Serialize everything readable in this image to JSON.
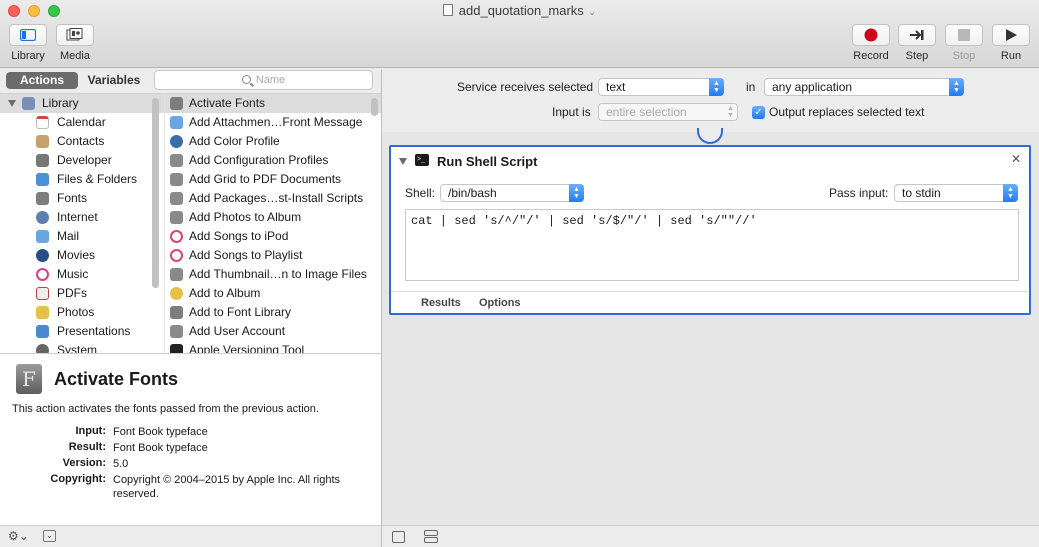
{
  "window": {
    "title": "add_quotation_marks"
  },
  "toolbar": {
    "library_label": "Library",
    "media_label": "Media",
    "record_label": "Record",
    "step_label": "Step",
    "stop_label": "Stop",
    "run_label": "Run"
  },
  "library": {
    "tab_actions": "Actions",
    "tab_variables": "Variables",
    "search_placeholder": "Name",
    "categories": [
      {
        "label": "Library",
        "icon": "library-icon",
        "color": "#7a8fb5"
      },
      {
        "label": "Calendar",
        "icon": "calendar-icon",
        "color": "#e8e8e8"
      },
      {
        "label": "Contacts",
        "icon": "contacts-icon",
        "color": "#c8a070"
      },
      {
        "label": "Developer",
        "icon": "developer-icon",
        "color": "#777777"
      },
      {
        "label": "Files & Folders",
        "icon": "finder-icon",
        "color": "#4a90d9"
      },
      {
        "label": "Fonts",
        "icon": "fonts-icon",
        "color": "#7d7d7d"
      },
      {
        "label": "Internet",
        "icon": "internet-icon",
        "color": "#5a7fb0"
      },
      {
        "label": "Mail",
        "icon": "mail-icon",
        "color": "#6aa6e0"
      },
      {
        "label": "Movies",
        "icon": "movies-icon",
        "color": "#2a4d8a"
      },
      {
        "label": "Music",
        "icon": "music-icon",
        "color": "#e0407a"
      },
      {
        "label": "PDFs",
        "icon": "pdf-icon",
        "color": "#d9d9d9"
      },
      {
        "label": "Photos",
        "icon": "photos-icon",
        "color": "#e6c14a"
      },
      {
        "label": "Presentations",
        "icon": "presentations-icon",
        "color": "#4a8ad0"
      },
      {
        "label": "System",
        "icon": "system-icon",
        "color": "#666666"
      }
    ],
    "actions": [
      {
        "label": "Activate Fonts",
        "icon": "font-book-icon",
        "color": "#7d7d7d"
      },
      {
        "label": "Add Attachmen…Front Message",
        "icon": "mail-icon",
        "color": "#6aa6e0"
      },
      {
        "label": "Add Color Profile",
        "icon": "colorsync-icon",
        "color": "#3a6ea8"
      },
      {
        "label": "Add Configuration Profiles",
        "icon": "automator-icon",
        "color": "#8a8a8a"
      },
      {
        "label": "Add Grid to PDF Documents",
        "icon": "automator-icon",
        "color": "#8a8a8a"
      },
      {
        "label": "Add Packages…st-Install Scripts",
        "icon": "automator-icon",
        "color": "#8a8a8a"
      },
      {
        "label": "Add Photos to Album",
        "icon": "automator-icon",
        "color": "#8a8a8a"
      },
      {
        "label": "Add Songs to iPod",
        "icon": "itunes-icon",
        "color": "#e0407a"
      },
      {
        "label": "Add Songs to Playlist",
        "icon": "itunes-icon",
        "color": "#e0407a"
      },
      {
        "label": "Add Thumbnail…n to Image Files",
        "icon": "automator-icon",
        "color": "#8a8a8a"
      },
      {
        "label": "Add to Album",
        "icon": "photos-icon",
        "color": "#e6c14a"
      },
      {
        "label": "Add to Font Library",
        "icon": "font-book-icon",
        "color": "#7d7d7d"
      },
      {
        "label": "Add User Account",
        "icon": "automator-icon",
        "color": "#8a8a8a"
      },
      {
        "label": "Apple Versioning Tool",
        "icon": "terminal-icon",
        "color": "#222222"
      }
    ]
  },
  "description": {
    "title": "Activate Fonts",
    "text": "This action activates the fonts passed from the previous action.",
    "input_label": "Input:",
    "input_value": "Font Book typeface",
    "result_label": "Result:",
    "result_value": "Font Book typeface",
    "version_label": "Version:",
    "version_value": "5.0",
    "copyright_label": "Copyright:",
    "copyright_value": "Copyright © 2004–2015 by Apple Inc. All rights reserved."
  },
  "service": {
    "receives_label": "Service receives selected",
    "receives_value": "text",
    "in_label": "in",
    "in_value": "any application",
    "input_is_label": "Input is",
    "input_is_value": "entire selection",
    "output_replaces_label": "Output replaces selected text",
    "output_replaces_checked": true
  },
  "action_card": {
    "title": "Run Shell Script",
    "shell_label": "Shell:",
    "shell_value": "/bin/bash",
    "pass_input_label": "Pass input:",
    "pass_input_value": "to stdin",
    "script": "cat | sed 's/^/\"/' | sed 's/$/\"/' | sed 's/\"\"//'",
    "tab_results": "Results",
    "tab_options": "Options"
  },
  "colors": {
    "accent": "#2d6ed6",
    "record": "#d0021b"
  }
}
